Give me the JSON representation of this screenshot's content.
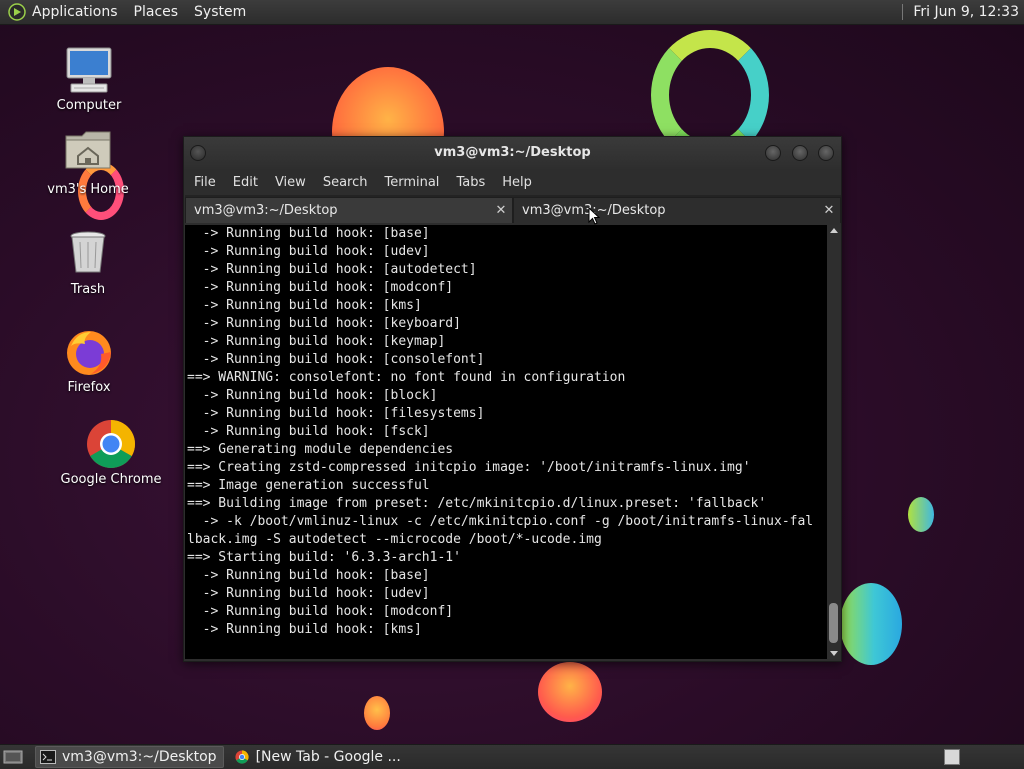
{
  "top_panel": {
    "menu_applications": "Applications",
    "menu_places": "Places",
    "menu_system": "System",
    "clock": "Fri Jun  9, 12:33"
  },
  "desktop_icons": [
    {
      "label": "Computer",
      "icon": "computer-icon"
    },
    {
      "label": "vm3's Home",
      "icon": "home-folder-icon"
    },
    {
      "label": "Trash",
      "icon": "trash-icon"
    },
    {
      "label": "Firefox",
      "icon": "firefox-icon"
    },
    {
      "label": "Google Chrome",
      "icon": "chrome-icon"
    }
  ],
  "terminal_window": {
    "title": "vm3@vm3:~/Desktop",
    "menu": [
      "File",
      "Edit",
      "View",
      "Search",
      "Terminal",
      "Tabs",
      "Help"
    ],
    "tabs": [
      {
        "label": "vm3@vm3:~/Desktop",
        "active": false
      },
      {
        "label": "vm3@vm3:~/Desktop",
        "active": true
      }
    ],
    "lines": [
      "  -> Running build hook: [base]",
      "  -> Running build hook: [udev]",
      "  -> Running build hook: [autodetect]",
      "  -> Running build hook: [modconf]",
      "  -> Running build hook: [kms]",
      "  -> Running build hook: [keyboard]",
      "  -> Running build hook: [keymap]",
      "  -> Running build hook: [consolefont]",
      "==> WARNING: consolefont: no font found in configuration",
      "  -> Running build hook: [block]",
      "  -> Running build hook: [filesystems]",
      "  -> Running build hook: [fsck]",
      "==> Generating module dependencies",
      "==> Creating zstd-compressed initcpio image: '/boot/initramfs-linux.img'",
      "==> Image generation successful",
      "==> Building image from preset: /etc/mkinitcpio.d/linux.preset: 'fallback'",
      "  -> -k /boot/vmlinuz-linux -c /etc/mkinitcpio.conf -g /boot/initramfs-linux-fal",
      "lback.img -S autodetect --microcode /boot/*-ucode.img",
      "==> Starting build: '6.3.3-arch1-1'",
      "  -> Running build hook: [base]",
      "  -> Running build hook: [udev]",
      "  -> Running build hook: [modconf]",
      "  -> Running build hook: [kms]"
    ]
  },
  "bottom_panel": {
    "tasks": [
      {
        "label": "vm3@vm3:~/Desktop",
        "icon": "terminal-icon",
        "active": true
      },
      {
        "label": "[New Tab - Google ...",
        "icon": "chrome-icon",
        "active": false
      }
    ]
  }
}
